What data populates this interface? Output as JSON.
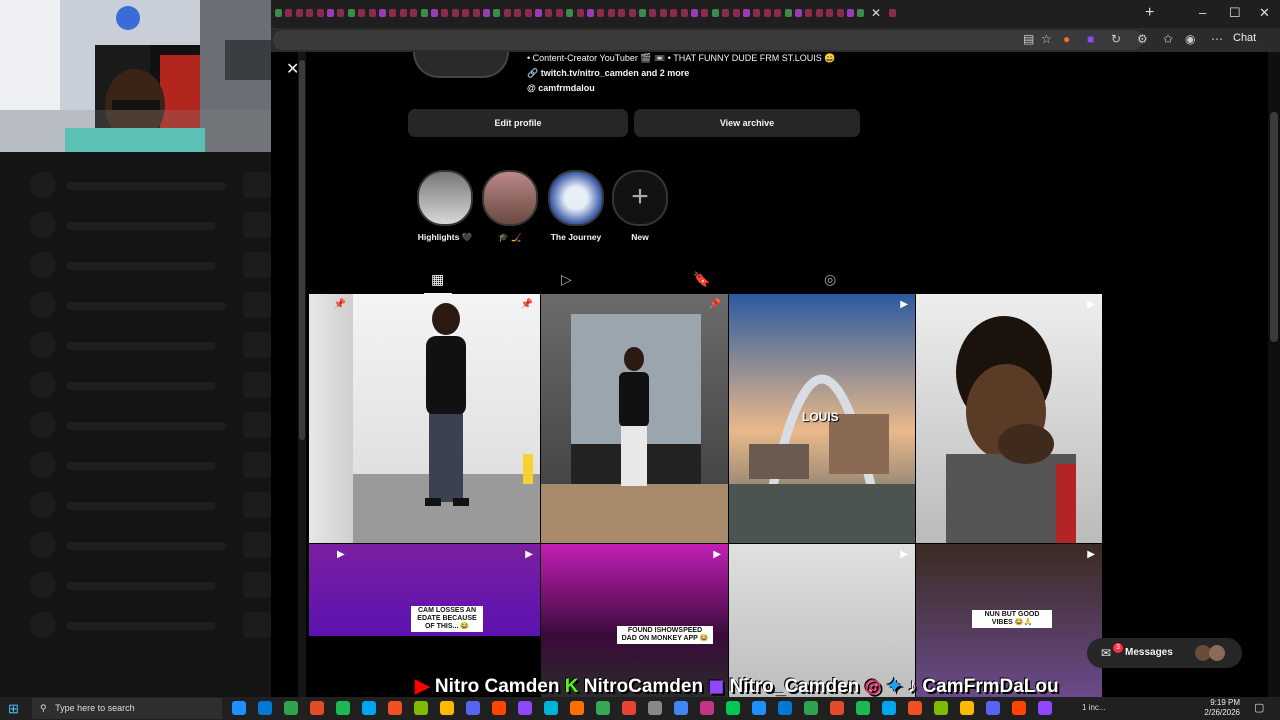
{
  "browser": {
    "new_tab_glyph": "+",
    "window_controls": [
      "–",
      "☐",
      "✕"
    ],
    "chat_label": "Chat"
  },
  "page": {
    "close_glyph": "✕",
    "bio_lines": [
      "• Content-Creator YouTuber 🎬 📼 • THAT FUNNY DUDE FRM ST.LOUIS 😄",
      "twitch.tv/nitro_camden and 2 more",
      "camfrmdalou"
    ],
    "edit_profile": "Edit profile",
    "view_archive": "View archive",
    "highlights": [
      {
        "label": "Highlights 🖤"
      },
      {
        "label": "🎓 🏒"
      },
      {
        "label": "The Journey"
      },
      {
        "label": "New",
        "glyph": "+"
      }
    ],
    "tabs": [
      "posts-grid",
      "reels",
      "saved",
      "tagged"
    ],
    "tab_glyphs": [
      "▦",
      "▷",
      "🔖",
      "◎"
    ],
    "post_overlays": [
      "CAM LOSSES AN EDATE BECAUSE OF THIS... 😂",
      "FOUND ISHOWSPEED DAD ON MONKEY APP 😂",
      "NUN BUT GOOD VIBES 😂🙏"
    ],
    "arch_text": "LOUIS",
    "messages_label": "Messages",
    "messages_count": "3"
  },
  "stream_overlay": {
    "youtube": "Nitro Camden",
    "kick": "NitroCamden",
    "twitch": "Nitro_Camden",
    "social": "CamFrmDaLou"
  },
  "taskbar": {
    "search_placeholder": "Type here to search",
    "time": "9:19 PM",
    "date": "2/26/2026",
    "notification_text": "1 inc..."
  },
  "colors": {
    "background": "#000000",
    "button_bg": "#262626",
    "text": "#f5f5f5",
    "badge": "#ff3040"
  }
}
